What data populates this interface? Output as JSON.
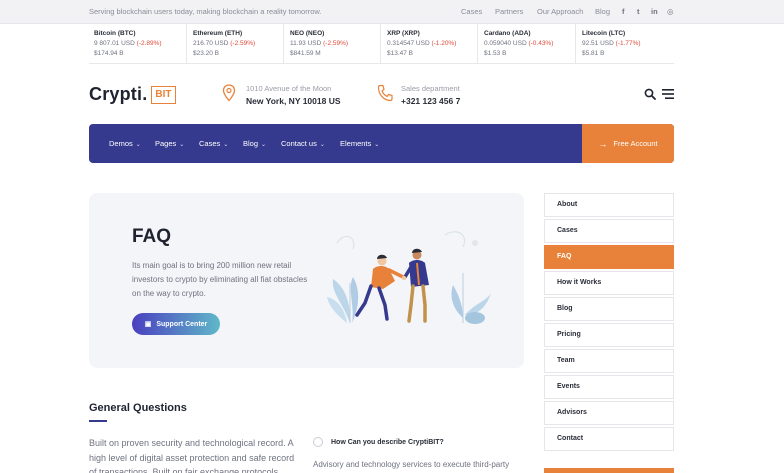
{
  "topbar": {
    "tagline": "Serving blockchain users today, making blockchain a reality tomorrow.",
    "links": [
      "Cases",
      "Partners",
      "Our Approach",
      "Blog"
    ],
    "social": [
      {
        "icon": "facebook-icon",
        "glyph": "f"
      },
      {
        "icon": "twitter-icon",
        "glyph": "t"
      },
      {
        "icon": "linkedin-icon",
        "glyph": "in"
      },
      {
        "icon": "instagram-icon",
        "glyph": "◎"
      }
    ]
  },
  "ticker": [
    {
      "name": "Bitcoin (BTC)",
      "price": "9 807.01 USD",
      "change": "(-2.89%)",
      "cap": "$174.94 B"
    },
    {
      "name": "Ethereum (ETH)",
      "price": "216.70 USD",
      "change": "(-2.59%)",
      "cap": "$23.20 B"
    },
    {
      "name": "NEO (NEO)",
      "price": "11.93 USD",
      "change": "(-2.59%)",
      "cap": "$841.59 M"
    },
    {
      "name": "XRP (XRP)",
      "price": "0.314547 USD",
      "change": "(-1.20%)",
      "cap": "$13.47 B"
    },
    {
      "name": "Cardano (ADA)",
      "price": "0.059040 USD",
      "change": "(-0.43%)",
      "cap": "$1.53 B"
    },
    {
      "name": "Litecoin (LTC)",
      "price": "92.51 USD",
      "change": "(-1.77%)",
      "cap": "$5.81 B"
    }
  ],
  "header": {
    "logo_word": "Crypti.",
    "logo_badge": "BIT",
    "address_label": "1010 Avenue of the Moon",
    "address_value": "New York, NY 10018 US",
    "sales_label": "Sales department",
    "sales_value": "+321 123 456 7"
  },
  "nav": {
    "items": [
      "Demos",
      "Pages",
      "Cases",
      "Blog",
      "Contact us",
      "Elements"
    ],
    "cta": "Free Account"
  },
  "hero": {
    "title": "FAQ",
    "text": "Its main goal is to bring 200 million new retail investors to crypto by eliminating all fiat obstacles on the way to crypto.",
    "button": "Support Center"
  },
  "sidebar": {
    "items": [
      "About",
      "Cases",
      "FAQ",
      "How it Works",
      "Blog",
      "Pricing",
      "Team",
      "Events",
      "Advisors",
      "Contact"
    ],
    "active": "FAQ"
  },
  "general": {
    "title": "General Questions",
    "text": "Built on proven security and technological record. A high level of digital asset protection and safe record of transactions. Built on fair exchange protocols.",
    "question": "How Can you describe CryptiBIT?",
    "answer": "Advisory and technology services to execute third-party"
  },
  "colors": {
    "primary": "#363a8e",
    "accent": "#e8823a",
    "negative": "#e04a3a"
  }
}
